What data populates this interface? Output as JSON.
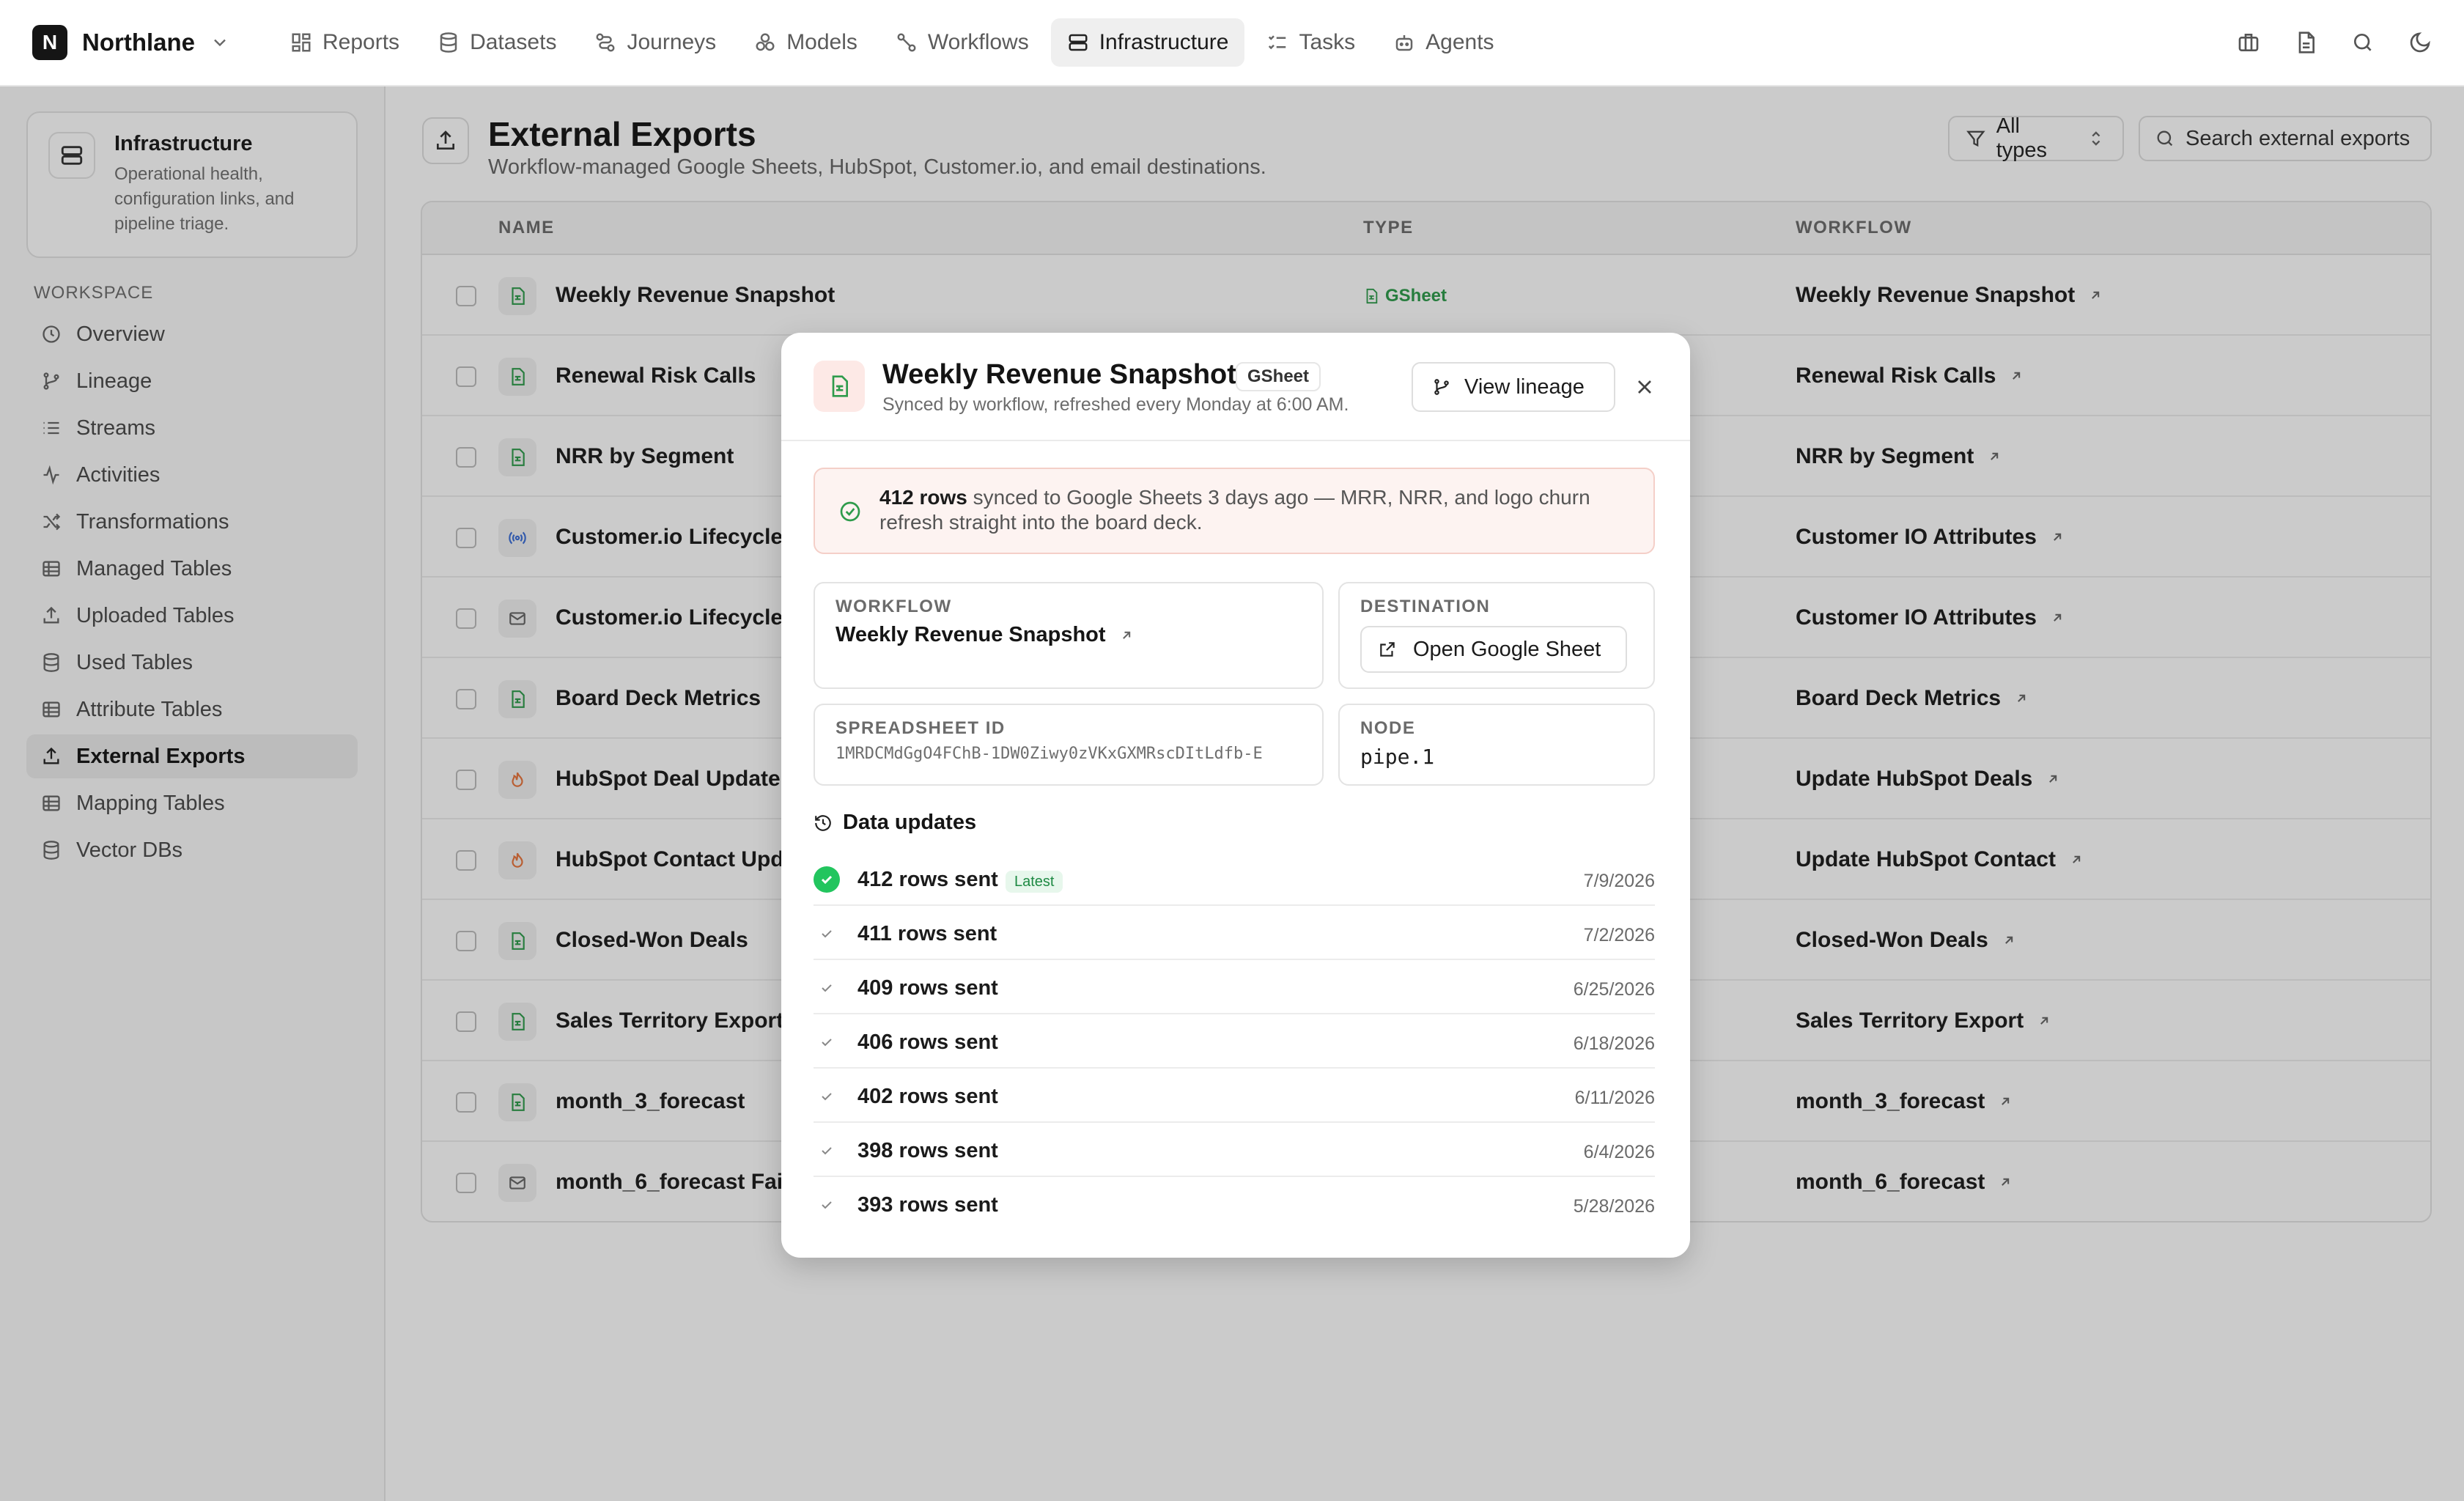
{
  "app": {
    "name": "Northlane",
    "logo_letter": "N"
  },
  "nav": [
    {
      "label": "Reports",
      "icon": "reports-icon"
    },
    {
      "label": "Datasets",
      "icon": "datasets-icon"
    },
    {
      "label": "Journeys",
      "icon": "journeys-icon"
    },
    {
      "label": "Models",
      "icon": "models-icon"
    },
    {
      "label": "Workflows",
      "icon": "workflows-icon"
    },
    {
      "label": "Infrastructure",
      "icon": "infrastructure-icon",
      "active": true
    },
    {
      "label": "Tasks",
      "icon": "tasks-icon"
    },
    {
      "label": "Agents",
      "icon": "agents-icon"
    }
  ],
  "sidebar": {
    "section_title": "Infrastructure",
    "section_desc": "Operational health, configuration links, and pipeline triage.",
    "workspace_label": "WORKSPACE",
    "items": [
      {
        "label": "Overview"
      },
      {
        "label": "Lineage"
      },
      {
        "label": "Streams"
      },
      {
        "label": "Activities"
      },
      {
        "label": "Transformations"
      },
      {
        "label": "Managed Tables"
      },
      {
        "label": "Uploaded Tables"
      },
      {
        "label": "Used Tables"
      },
      {
        "label": "Attribute Tables"
      },
      {
        "label": "External Exports",
        "active": true
      },
      {
        "label": "Mapping Tables"
      },
      {
        "label": "Vector DBs"
      }
    ]
  },
  "page": {
    "title": "External Exports",
    "subtitle": "Workflow-managed Google Sheets, HubSpot, Customer.io, and email destinations.",
    "filter_label": "All types",
    "search_placeholder": "Search external exports"
  },
  "table": {
    "columns": {
      "name": "NAME",
      "type": "TYPE",
      "workflow": "WORKFLOW"
    },
    "rows": [
      {
        "name": "Weekly Revenue Snapshot",
        "type": "GSheet",
        "kind": "sheet",
        "workflow": "Weekly Revenue Snapshot"
      },
      {
        "name": "Renewal Risk Calls",
        "type": "",
        "kind": "sheet",
        "workflow": "Renewal Risk Calls"
      },
      {
        "name": "NRR by Segment",
        "type": "",
        "kind": "sheet",
        "workflow": "NRR by Segment"
      },
      {
        "name": "Customer.io Lifecycle S",
        "type": "",
        "kind": "broadcast",
        "workflow": "Customer IO Attributes"
      },
      {
        "name": "Customer.io Lifecycle S",
        "type": "",
        "kind": "mail",
        "workflow": "Customer IO Attributes"
      },
      {
        "name": "Board Deck Metrics",
        "type": "",
        "kind": "sheet",
        "workflow": "Board Deck Metrics"
      },
      {
        "name": "HubSpot Deal Update",
        "type": "",
        "kind": "hubspot",
        "workflow": "Update HubSpot Deals"
      },
      {
        "name": "HubSpot Contact Upda",
        "type": "",
        "kind": "hubspot",
        "workflow": "Update HubSpot Contact"
      },
      {
        "name": "Closed-Won Deals",
        "type": "",
        "kind": "sheet",
        "workflow": "Closed-Won Deals"
      },
      {
        "name": "Sales Territory Export",
        "type": "",
        "kind": "sheet",
        "workflow": "Sales Territory Export"
      },
      {
        "name": "month_3_forecast",
        "type": "",
        "kind": "sheet",
        "workflow": "month_3_forecast"
      },
      {
        "name": "month_6_forecast Failu",
        "type": "",
        "kind": "mail",
        "workflow": "month_6_forecast"
      }
    ]
  },
  "modal": {
    "title": "Weekly Revenue Snapshot",
    "badge": "GSheet",
    "subtitle": "Synced by workflow, refreshed every Monday at 6:00 AM.",
    "lineage_button": "View lineage",
    "alert_bold": "412 rows",
    "alert_text": " synced to Google Sheets 3 days ago — MRR, NRR, and logo churn refresh straight into the board deck.",
    "workflow_label": "WORKFLOW",
    "workflow_value": "Weekly Revenue Snapshot",
    "destination_label": "DESTINATION",
    "destination_button": "Open Google Sheet",
    "spreadsheet_label": "SPREADSHEET ID",
    "spreadsheet_value": "1MRDCMdGgO4FChB-1DW0Ziwy0zVKxGXMRscDItLdfb-E",
    "node_label": "NODE",
    "node_value": "pipe.1",
    "updates_title": "Data updates",
    "latest_label": "Latest",
    "updates": [
      {
        "rows": "412 rows sent",
        "date": "7/9/2026",
        "latest": true
      },
      {
        "rows": "411 rows sent",
        "date": "7/2/2026"
      },
      {
        "rows": "409 rows sent",
        "date": "6/25/2026"
      },
      {
        "rows": "406 rows sent",
        "date": "6/18/2026"
      },
      {
        "rows": "402 rows sent",
        "date": "6/11/2026"
      },
      {
        "rows": "398 rows sent",
        "date": "6/4/2026"
      },
      {
        "rows": "393 rows sent",
        "date": "5/28/2026"
      }
    ]
  },
  "colors": {
    "accent_green": "#22c55e",
    "sheet_green": "#2e9b4b",
    "hubspot_orange": "#e8743b",
    "alert_bg": "#fdf3f1"
  }
}
